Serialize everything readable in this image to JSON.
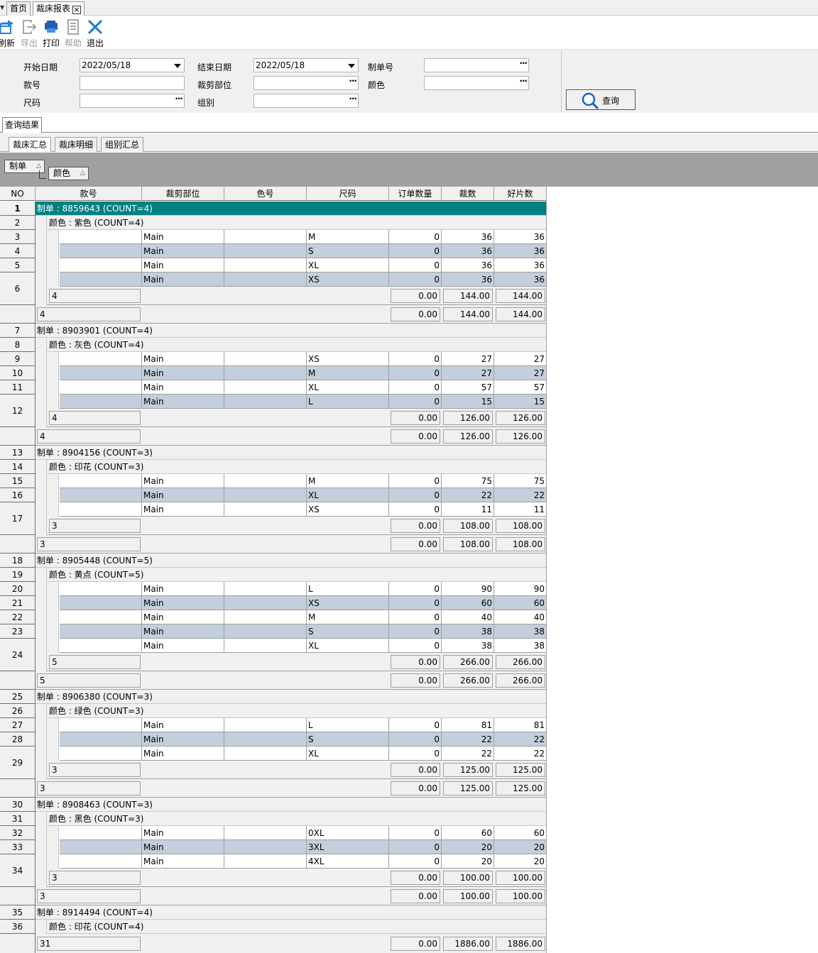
{
  "tabs": {
    "home": "首页",
    "report": "裁床报表"
  },
  "toolbar": {
    "refresh": "刷新",
    "export": "导出",
    "print": "打印",
    "help": "帮助",
    "exit": "退出"
  },
  "filters": {
    "start_date_label": "开始日期",
    "start_date": "2022/05/18",
    "end_date_label": "结束日期",
    "end_date": "2022/05/18",
    "order_label": "制单号",
    "order_value": "",
    "style_label": "款号",
    "style_value": "",
    "cut_part_label": "裁剪部位",
    "cut_part_value": "",
    "color_label": "颜色",
    "color_value": "",
    "size_label": "尺码",
    "size_value": "",
    "team_label": "组别",
    "team_value": "",
    "query_button": "查询"
  },
  "result_title": "查询结果",
  "subtabs": [
    "裁床汇总",
    "裁床明细",
    "组别汇总"
  ],
  "group_by": {
    "first": "制单",
    "second": "颜色"
  },
  "columns": {
    "no": "NO",
    "style": "款号",
    "part": "裁剪部位",
    "color_no": "色号",
    "size": "尺码",
    "order_qty": "订单数量",
    "cut_qty": "裁数",
    "good_qty": "好片数"
  },
  "groups": [
    {
      "no": "1",
      "label": "制单 : 8859643 (COUNT=4)",
      "color_no": "2",
      "color_label": "颜色 : 紫色 (COUNT=4)",
      "rows": [
        {
          "no": "3",
          "part": "Main",
          "size": "M",
          "order": "0",
          "cut": "36",
          "good": "36"
        },
        {
          "no": "4",
          "part": "Main",
          "size": "S",
          "order": "0",
          "cut": "36",
          "good": "36"
        },
        {
          "no": "5",
          "part": "Main",
          "size": "XL",
          "order": "0",
          "cut": "36",
          "good": "36"
        },
        {
          "no": "6",
          "part": "Main",
          "size": "XS",
          "order": "0",
          "cut": "36",
          "good": "36"
        }
      ],
      "color_sum": {
        "count": "4",
        "order": "0.00",
        "cut": "144.00",
        "good": "144.00"
      },
      "order_sum": {
        "count": "4",
        "order": "0.00",
        "cut": "144.00",
        "good": "144.00"
      }
    },
    {
      "no": "7",
      "label": "制单 : 8903901 (COUNT=4)",
      "color_no": "8",
      "color_label": "颜色 : 灰色 (COUNT=4)",
      "rows": [
        {
          "no": "9",
          "part": "Main",
          "size": "XS",
          "order": "0",
          "cut": "27",
          "good": "27"
        },
        {
          "no": "10",
          "part": "Main",
          "size": "M",
          "order": "0",
          "cut": "27",
          "good": "27"
        },
        {
          "no": "11",
          "part": "Main",
          "size": "XL",
          "order": "0",
          "cut": "57",
          "good": "57"
        },
        {
          "no": "12",
          "part": "Main",
          "size": "L",
          "order": "0",
          "cut": "15",
          "good": "15"
        }
      ],
      "color_sum": {
        "count": "4",
        "order": "0.00",
        "cut": "126.00",
        "good": "126.00"
      },
      "order_sum": {
        "count": "4",
        "order": "0.00",
        "cut": "126.00",
        "good": "126.00"
      }
    },
    {
      "no": "13",
      "label": "制单 : 8904156 (COUNT=3)",
      "color_no": "14",
      "color_label": "颜色 : 印花 (COUNT=3)",
      "rows": [
        {
          "no": "15",
          "part": "Main",
          "size": "M",
          "order": "0",
          "cut": "75",
          "good": "75"
        },
        {
          "no": "16",
          "part": "Main",
          "size": "XL",
          "order": "0",
          "cut": "22",
          "good": "22"
        },
        {
          "no": "17",
          "part": "Main",
          "size": "XS",
          "order": "0",
          "cut": "11",
          "good": "11"
        }
      ],
      "color_sum": {
        "count": "3",
        "order": "0.00",
        "cut": "108.00",
        "good": "108.00"
      },
      "order_sum": {
        "count": "3",
        "order": "0.00",
        "cut": "108.00",
        "good": "108.00"
      }
    },
    {
      "no": "18",
      "label": "制单 : 8905448 (COUNT=5)",
      "color_no": "19",
      "color_label": "颜色 : 黄点 (COUNT=5)",
      "rows": [
        {
          "no": "20",
          "part": "Main",
          "size": "L",
          "order": "0",
          "cut": "90",
          "good": "90"
        },
        {
          "no": "21",
          "part": "Main",
          "size": "XS",
          "order": "0",
          "cut": "60",
          "good": "60"
        },
        {
          "no": "22",
          "part": "Main",
          "size": "M",
          "order": "0",
          "cut": "40",
          "good": "40"
        },
        {
          "no": "23",
          "part": "Main",
          "size": "S",
          "order": "0",
          "cut": "38",
          "good": "38"
        },
        {
          "no": "24",
          "part": "Main",
          "size": "XL",
          "order": "0",
          "cut": "38",
          "good": "38"
        }
      ],
      "color_sum": {
        "count": "5",
        "order": "0.00",
        "cut": "266.00",
        "good": "266.00"
      },
      "order_sum": {
        "count": "5",
        "order": "0.00",
        "cut": "266.00",
        "good": "266.00"
      }
    },
    {
      "no": "25",
      "label": "制单 : 8906380 (COUNT=3)",
      "color_no": "26",
      "color_label": "颜色 : 绿色 (COUNT=3)",
      "rows": [
        {
          "no": "27",
          "part": "Main",
          "size": "L",
          "order": "0",
          "cut": "81",
          "good": "81"
        },
        {
          "no": "28",
          "part": "Main",
          "size": "S",
          "order": "0",
          "cut": "22",
          "good": "22"
        },
        {
          "no": "29",
          "part": "Main",
          "size": "XL",
          "order": "0",
          "cut": "22",
          "good": "22"
        }
      ],
      "color_sum": {
        "count": "3",
        "order": "0.00",
        "cut": "125.00",
        "good": "125.00"
      },
      "order_sum": {
        "count": "3",
        "order": "0.00",
        "cut": "125.00",
        "good": "125.00"
      }
    },
    {
      "no": "30",
      "label": "制单 : 8908463 (COUNT=3)",
      "color_no": "31",
      "color_label": "颜色 : 黑色 (COUNT=3)",
      "rows": [
        {
          "no": "32",
          "part": "Main",
          "size": "0XL",
          "order": "0",
          "cut": "60",
          "good": "60"
        },
        {
          "no": "33",
          "part": "Main",
          "size": "3XL",
          "order": "0",
          "cut": "20",
          "good": "20"
        },
        {
          "no": "34",
          "part": "Main",
          "size": "4XL",
          "order": "0",
          "cut": "20",
          "good": "20"
        }
      ],
      "color_sum": {
        "count": "3",
        "order": "0.00",
        "cut": "100.00",
        "good": "100.00"
      },
      "order_sum": {
        "count": "3",
        "order": "0.00",
        "cut": "100.00",
        "good": "100.00"
      }
    }
  ],
  "tail": {
    "order_no": "35",
    "order_label": "制单 : 8914494 (COUNT=4)",
    "color_no": "36",
    "color_label": "颜色 : 印花 (COUNT=4)"
  },
  "grand_total": {
    "count": "31",
    "order": "0.00",
    "cut": "1886.00",
    "good": "1886.00"
  },
  "colors": {
    "selected_row": "#008080",
    "alt_row": "#c3cfdc",
    "group_panel": "#a0a0a0"
  }
}
